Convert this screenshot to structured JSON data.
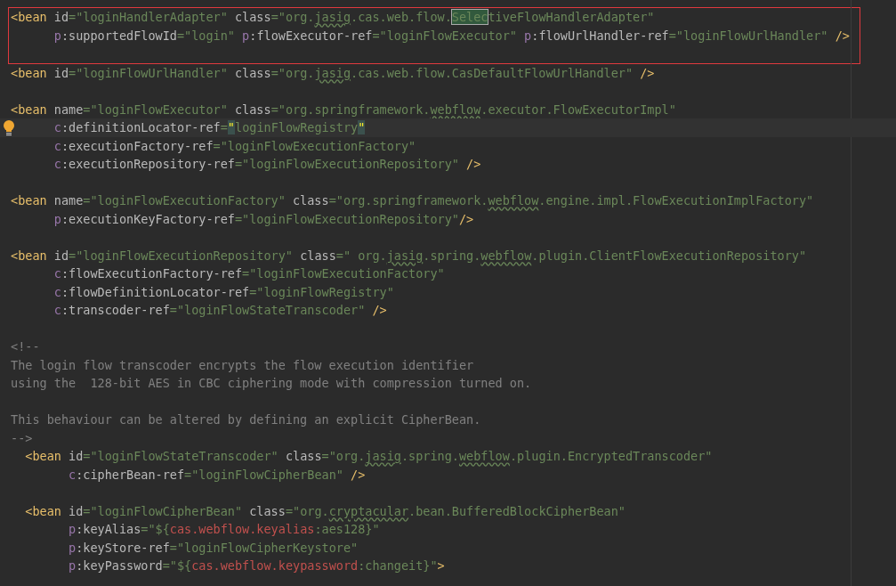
{
  "editor": {
    "framed_lines": [
      {
        "current": false,
        "tokens": [
          {
            "kind": "tag",
            "text": "<bean"
          },
          {
            "kind": "attr",
            "text": " id"
          },
          {
            "kind": "str",
            "text": "=\"loginHandlerAdapter\""
          },
          {
            "kind": "attr",
            "text": " class"
          },
          {
            "kind": "str",
            "text": "=\"org."
          },
          {
            "kind": "typo",
            "text": "jasig"
          },
          {
            "kind": "str",
            "text": ".cas.web.flow."
          },
          {
            "kind": "match",
            "text": "Selec"
          },
          {
            "kind": "str",
            "text": "tiveFlowHandlerAdapter\""
          }
        ]
      },
      {
        "current": false,
        "tokens": [
          {
            "kind": "ns",
            "text": "      p"
          },
          {
            "kind": "attr",
            "text": ":supportedFlowId"
          },
          {
            "kind": "str",
            "text": "=\"login\""
          },
          {
            "kind": "ns",
            "text": " p"
          },
          {
            "kind": "attr",
            "text": ":flowExecutor-ref"
          },
          {
            "kind": "str",
            "text": "=\"loginFlowExecutor\""
          },
          {
            "kind": "ns",
            "text": " p"
          },
          {
            "kind": "attr",
            "text": ":flowUrlHandler-ref"
          },
          {
            "kind": "str",
            "text": "=\"loginFlowUrlHandler\""
          },
          {
            "kind": "tag",
            "text": " />"
          }
        ]
      },
      {
        "current": false
      }
    ],
    "lines": [
      {
        "current": false,
        "tokens": [
          {
            "kind": "tag",
            "text": "<bean"
          },
          {
            "kind": "attr",
            "text": " id"
          },
          {
            "kind": "str",
            "text": "=\"loginFlowUrlHandler\""
          },
          {
            "kind": "attr",
            "text": " class"
          },
          {
            "kind": "str",
            "text": "=\"org."
          },
          {
            "kind": "typo",
            "text": "jasig"
          },
          {
            "kind": "str",
            "text": ".cas.web.flow.CasDefaultFlowUrlHandler\""
          },
          {
            "kind": "tag",
            "text": " />"
          }
        ]
      },
      {
        "current": false
      },
      {
        "current": false,
        "tokens": [
          {
            "kind": "tag",
            "text": "<bean"
          },
          {
            "kind": "attr",
            "text": " name"
          },
          {
            "kind": "str",
            "text": "=\"loginFlowExecutor\""
          },
          {
            "kind": "attr",
            "text": " class"
          },
          {
            "kind": "str",
            "text": "=\"org.springframework."
          },
          {
            "kind": "typo",
            "text": "webflow"
          },
          {
            "kind": "str",
            "text": ".executor.FlowExecutorImpl\""
          }
        ]
      },
      {
        "current": true,
        "tokens": [
          {
            "kind": "ns",
            "text": "      c"
          },
          {
            "kind": "attr",
            "text": ":definitionLocator-ref"
          },
          {
            "kind": "str",
            "text": "="
          },
          {
            "kind": "brace",
            "text": "\""
          },
          {
            "kind": "str",
            "text": "loginFlowRegistry"
          },
          {
            "kind": "brace",
            "text": "\""
          }
        ]
      },
      {
        "current": false,
        "tokens": [
          {
            "kind": "ns",
            "text": "      c"
          },
          {
            "kind": "attr",
            "text": ":executionFactory-ref"
          },
          {
            "kind": "str",
            "text": "=\"loginFlowExecutionFactory\""
          }
        ]
      },
      {
        "current": false,
        "tokens": [
          {
            "kind": "ns",
            "text": "      c"
          },
          {
            "kind": "attr",
            "text": ":executionRepository-ref"
          },
          {
            "kind": "str",
            "text": "=\"loginFlowExecutionRepository\""
          },
          {
            "kind": "tag",
            "text": " />"
          }
        ]
      },
      {
        "current": false
      },
      {
        "current": false,
        "tokens": [
          {
            "kind": "tag",
            "text": "<bean"
          },
          {
            "kind": "attr",
            "text": " name"
          },
          {
            "kind": "str",
            "text": "=\"loginFlowExecutionFactory\""
          },
          {
            "kind": "attr",
            "text": " class"
          },
          {
            "kind": "str",
            "text": "=\"org.springframework."
          },
          {
            "kind": "typo",
            "text": "webflow"
          },
          {
            "kind": "str",
            "text": ".engine.impl.FlowExecutionImplFactory\""
          }
        ]
      },
      {
        "current": false,
        "tokens": [
          {
            "kind": "ns",
            "text": "      p"
          },
          {
            "kind": "attr",
            "text": ":executionKeyFactory-ref"
          },
          {
            "kind": "str",
            "text": "=\"loginFlowExecutionRepository\""
          },
          {
            "kind": "tag",
            "text": "/>"
          }
        ]
      },
      {
        "current": false
      },
      {
        "current": false,
        "tokens": [
          {
            "kind": "tag",
            "text": "<bean"
          },
          {
            "kind": "attr",
            "text": " id"
          },
          {
            "kind": "str",
            "text": "=\"loginFlowExecutionRepository\""
          },
          {
            "kind": "attr",
            "text": " class"
          },
          {
            "kind": "str",
            "text": "=\" org."
          },
          {
            "kind": "typo",
            "text": "jasig"
          },
          {
            "kind": "str",
            "text": ".spring."
          },
          {
            "kind": "typo",
            "text": "webflow"
          },
          {
            "kind": "str",
            "text": ".plugin.ClientFlowExecutionRepository\""
          }
        ]
      },
      {
        "current": false,
        "tokens": [
          {
            "kind": "ns",
            "text": "      c"
          },
          {
            "kind": "attr",
            "text": ":flowExecutionFactory-ref"
          },
          {
            "kind": "str",
            "text": "=\"loginFlowExecutionFactory\""
          }
        ]
      },
      {
        "current": false,
        "tokens": [
          {
            "kind": "ns",
            "text": "      c"
          },
          {
            "kind": "attr",
            "text": ":flowDefinitionLocator-ref"
          },
          {
            "kind": "str",
            "text": "=\"loginFlowRegistry\""
          }
        ]
      },
      {
        "current": false,
        "tokens": [
          {
            "kind": "ns",
            "text": "      c"
          },
          {
            "kind": "attr",
            "text": ":transcoder-ref"
          },
          {
            "kind": "str",
            "text": "=\"loginFlowStateTranscoder\""
          },
          {
            "kind": "tag",
            "text": " />"
          }
        ]
      },
      {
        "current": false
      },
      {
        "current": false,
        "tokens": [
          {
            "kind": "comment",
            "text": "<!--"
          }
        ]
      },
      {
        "current": false,
        "tokens": [
          {
            "kind": "comment",
            "text": "The login flow transcoder encrypts the flow execution identifier"
          }
        ]
      },
      {
        "current": false,
        "tokens": [
          {
            "kind": "comment",
            "text": "using the  128-bit AES in CBC ciphering mode with compression turned on."
          }
        ]
      },
      {
        "current": false
      },
      {
        "current": false,
        "tokens": [
          {
            "kind": "comment",
            "text": "This behaviour can be altered by defining an explicit CipherBean."
          }
        ]
      },
      {
        "current": false,
        "tokens": [
          {
            "kind": "comment",
            "text": "-->"
          }
        ]
      },
      {
        "current": false,
        "tokens": [
          {
            "kind": "tag",
            "text": "  <bean"
          },
          {
            "kind": "attr",
            "text": " id"
          },
          {
            "kind": "str",
            "text": "=\"loginFlowStateTranscoder\""
          },
          {
            "kind": "attr",
            "text": " class"
          },
          {
            "kind": "str",
            "text": "=\"org."
          },
          {
            "kind": "typo",
            "text": "jasig"
          },
          {
            "kind": "str",
            "text": ".spring."
          },
          {
            "kind": "typo",
            "text": "webflow"
          },
          {
            "kind": "str",
            "text": ".plugin.EncryptedTranscoder\""
          }
        ]
      },
      {
        "current": false,
        "tokens": [
          {
            "kind": "ns",
            "text": "        c"
          },
          {
            "kind": "attr",
            "text": ":cipherBean-ref"
          },
          {
            "kind": "str",
            "text": "=\"loginFlowCipherBean\""
          },
          {
            "kind": "tag",
            "text": " />"
          }
        ]
      },
      {
        "current": false
      },
      {
        "current": false,
        "tokens": [
          {
            "kind": "tag",
            "text": "  <bean"
          },
          {
            "kind": "attr",
            "text": " id"
          },
          {
            "kind": "str",
            "text": "=\"loginFlowCipherBean\""
          },
          {
            "kind": "attr",
            "text": " class"
          },
          {
            "kind": "str",
            "text": "=\"org."
          },
          {
            "kind": "typo",
            "text": "cryptacular"
          },
          {
            "kind": "str",
            "text": ".bean.BufferedBlockCipherBean\""
          }
        ]
      },
      {
        "current": false,
        "tokens": [
          {
            "kind": "ns",
            "text": "        p"
          },
          {
            "kind": "attr",
            "text": ":keyAlias"
          },
          {
            "kind": "str",
            "text": "=\"${"
          },
          {
            "kind": "placeholder",
            "text": "cas.webflow.keyalias"
          },
          {
            "kind": "str",
            "text": ":aes128}\""
          }
        ]
      },
      {
        "current": false,
        "tokens": [
          {
            "kind": "ns",
            "text": "        p"
          },
          {
            "kind": "attr",
            "text": ":keyStore-ref"
          },
          {
            "kind": "str",
            "text": "=\"loginFlowCipherKeystore\""
          }
        ]
      },
      {
        "current": false,
        "tokens": [
          {
            "kind": "ns",
            "text": "        p"
          },
          {
            "kind": "attr",
            "text": ":keyPassword"
          },
          {
            "kind": "str",
            "text": "=\"${"
          },
          {
            "kind": "placeholder",
            "text": "cas.webflow.keypassword"
          },
          {
            "kind": "str",
            "text": ":changeit}\""
          },
          {
            "kind": "tag",
            "text": ">"
          }
        ]
      }
    ]
  }
}
